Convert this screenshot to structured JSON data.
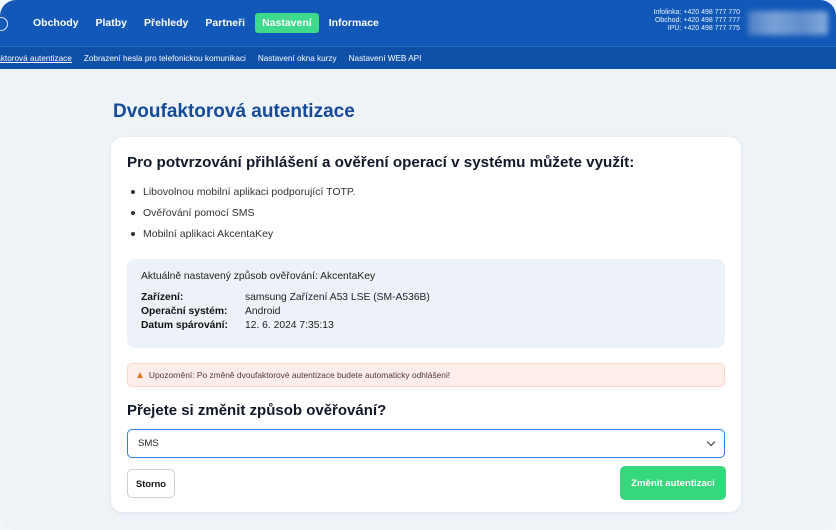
{
  "nav": {
    "items": [
      "Obchody",
      "Platby",
      "Přehledy",
      "Partneři",
      "Nastavení",
      "Informace"
    ],
    "active": "Nastavení",
    "contact": [
      "Infolinka: +420 498 777 770",
      "Obchod: +420 498 777 777",
      "IPÚ: +420 498 777 775"
    ]
  },
  "subnav": {
    "items": [
      "faktorová autentizace",
      "Zobrazení hesla pro telefonickou komunikaci",
      "Nastavení okna kurzy",
      "Nastavení WEB API"
    ]
  },
  "page": {
    "title": "Dvoufaktorová autentizace"
  },
  "card": {
    "heading": "Pro potvrzování přihlášení a ověření operací v systému můžete využít:",
    "options": [
      "Libovolnou mobilní aplikaci podporující TOTP.",
      "Ověřování pomocí SMS",
      "Mobilní aplikaci AkcentaKey"
    ],
    "info": {
      "current": "Aktuálně nastavený způsob ověřování: AkcentaKey",
      "rows": [
        {
          "label": "Zařízení:",
          "value": "samsung Zařízení A53 LSE (SM-A536B)"
        },
        {
          "label": "Operační systém:",
          "value": "Android"
        },
        {
          "label": "Datum spárování:",
          "value": "12. 6. 2024 7:35:13"
        }
      ]
    },
    "warning": "Upozornění: Po změně dvoufaktorové autentizace budete automaticky odhlášeni!",
    "question": "Přejete si změnit způsob ověřování?",
    "select": {
      "value": "SMS"
    },
    "cancel_label": "Storno",
    "submit_label": "Změnit autentizaci"
  },
  "colors": {
    "topbar": "#1158b8",
    "subbar": "#0e4fa8",
    "active_tab": "#3fd98b",
    "title": "#144a9a",
    "submit": "#35d97c",
    "warning_bg": "#fdeee9"
  },
  "icons": {
    "warning": "warning-triangle-icon",
    "select": "chevron-down-icon"
  }
}
